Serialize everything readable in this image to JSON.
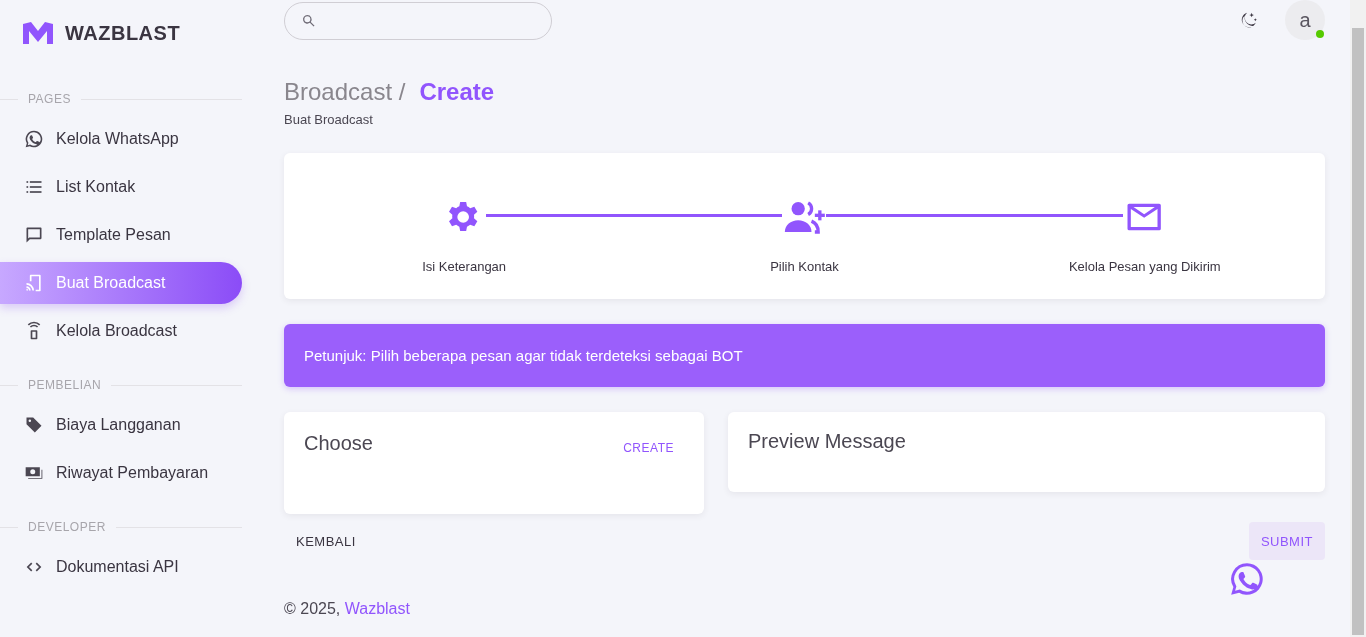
{
  "brand": {
    "name": "WAZBLAST"
  },
  "sidebar": {
    "sections": [
      {
        "heading": "PAGES",
        "items": [
          {
            "label": "Kelola WhatsApp",
            "selected": false
          },
          {
            "label": "List Kontak",
            "selected": false
          },
          {
            "label": "Template Pesan",
            "selected": false
          },
          {
            "label": "Buat Broadcast",
            "selected": true
          },
          {
            "label": "Kelola Broadcast",
            "selected": false
          }
        ]
      },
      {
        "heading": "PEMBELIAN",
        "items": [
          {
            "label": "Biaya Langganan",
            "selected": false
          },
          {
            "label": "Riwayat Pembayaran",
            "selected": false
          }
        ]
      },
      {
        "heading": "DEVELOPER",
        "items": [
          {
            "label": "Dokumentasi API",
            "selected": false
          }
        ]
      }
    ]
  },
  "topbar": {
    "avatar": {
      "letter": "a",
      "online": true
    }
  },
  "page_header": {
    "parent": "Broadcast /",
    "current": "Create",
    "subtitle": "Buat Broadcast"
  },
  "stepper": {
    "steps": [
      {
        "label": "Isi Keterangan"
      },
      {
        "label": "Pilih Kontak"
      },
      {
        "label": "Kelola Pesan yang Dikirim"
      }
    ]
  },
  "alert": {
    "text": "Petunjuk: Pilih beberapa pesan agar tidak terdeteksi sebagai BOT"
  },
  "choose_card": {
    "title": "Choose",
    "action": "CREATE"
  },
  "preview_card": {
    "title": "Preview Message"
  },
  "actions": {
    "back": "KEMBALI",
    "submit": "SUBMIT"
  },
  "footer": {
    "prefix": "© 2025,",
    "link": "Wazblast"
  }
}
